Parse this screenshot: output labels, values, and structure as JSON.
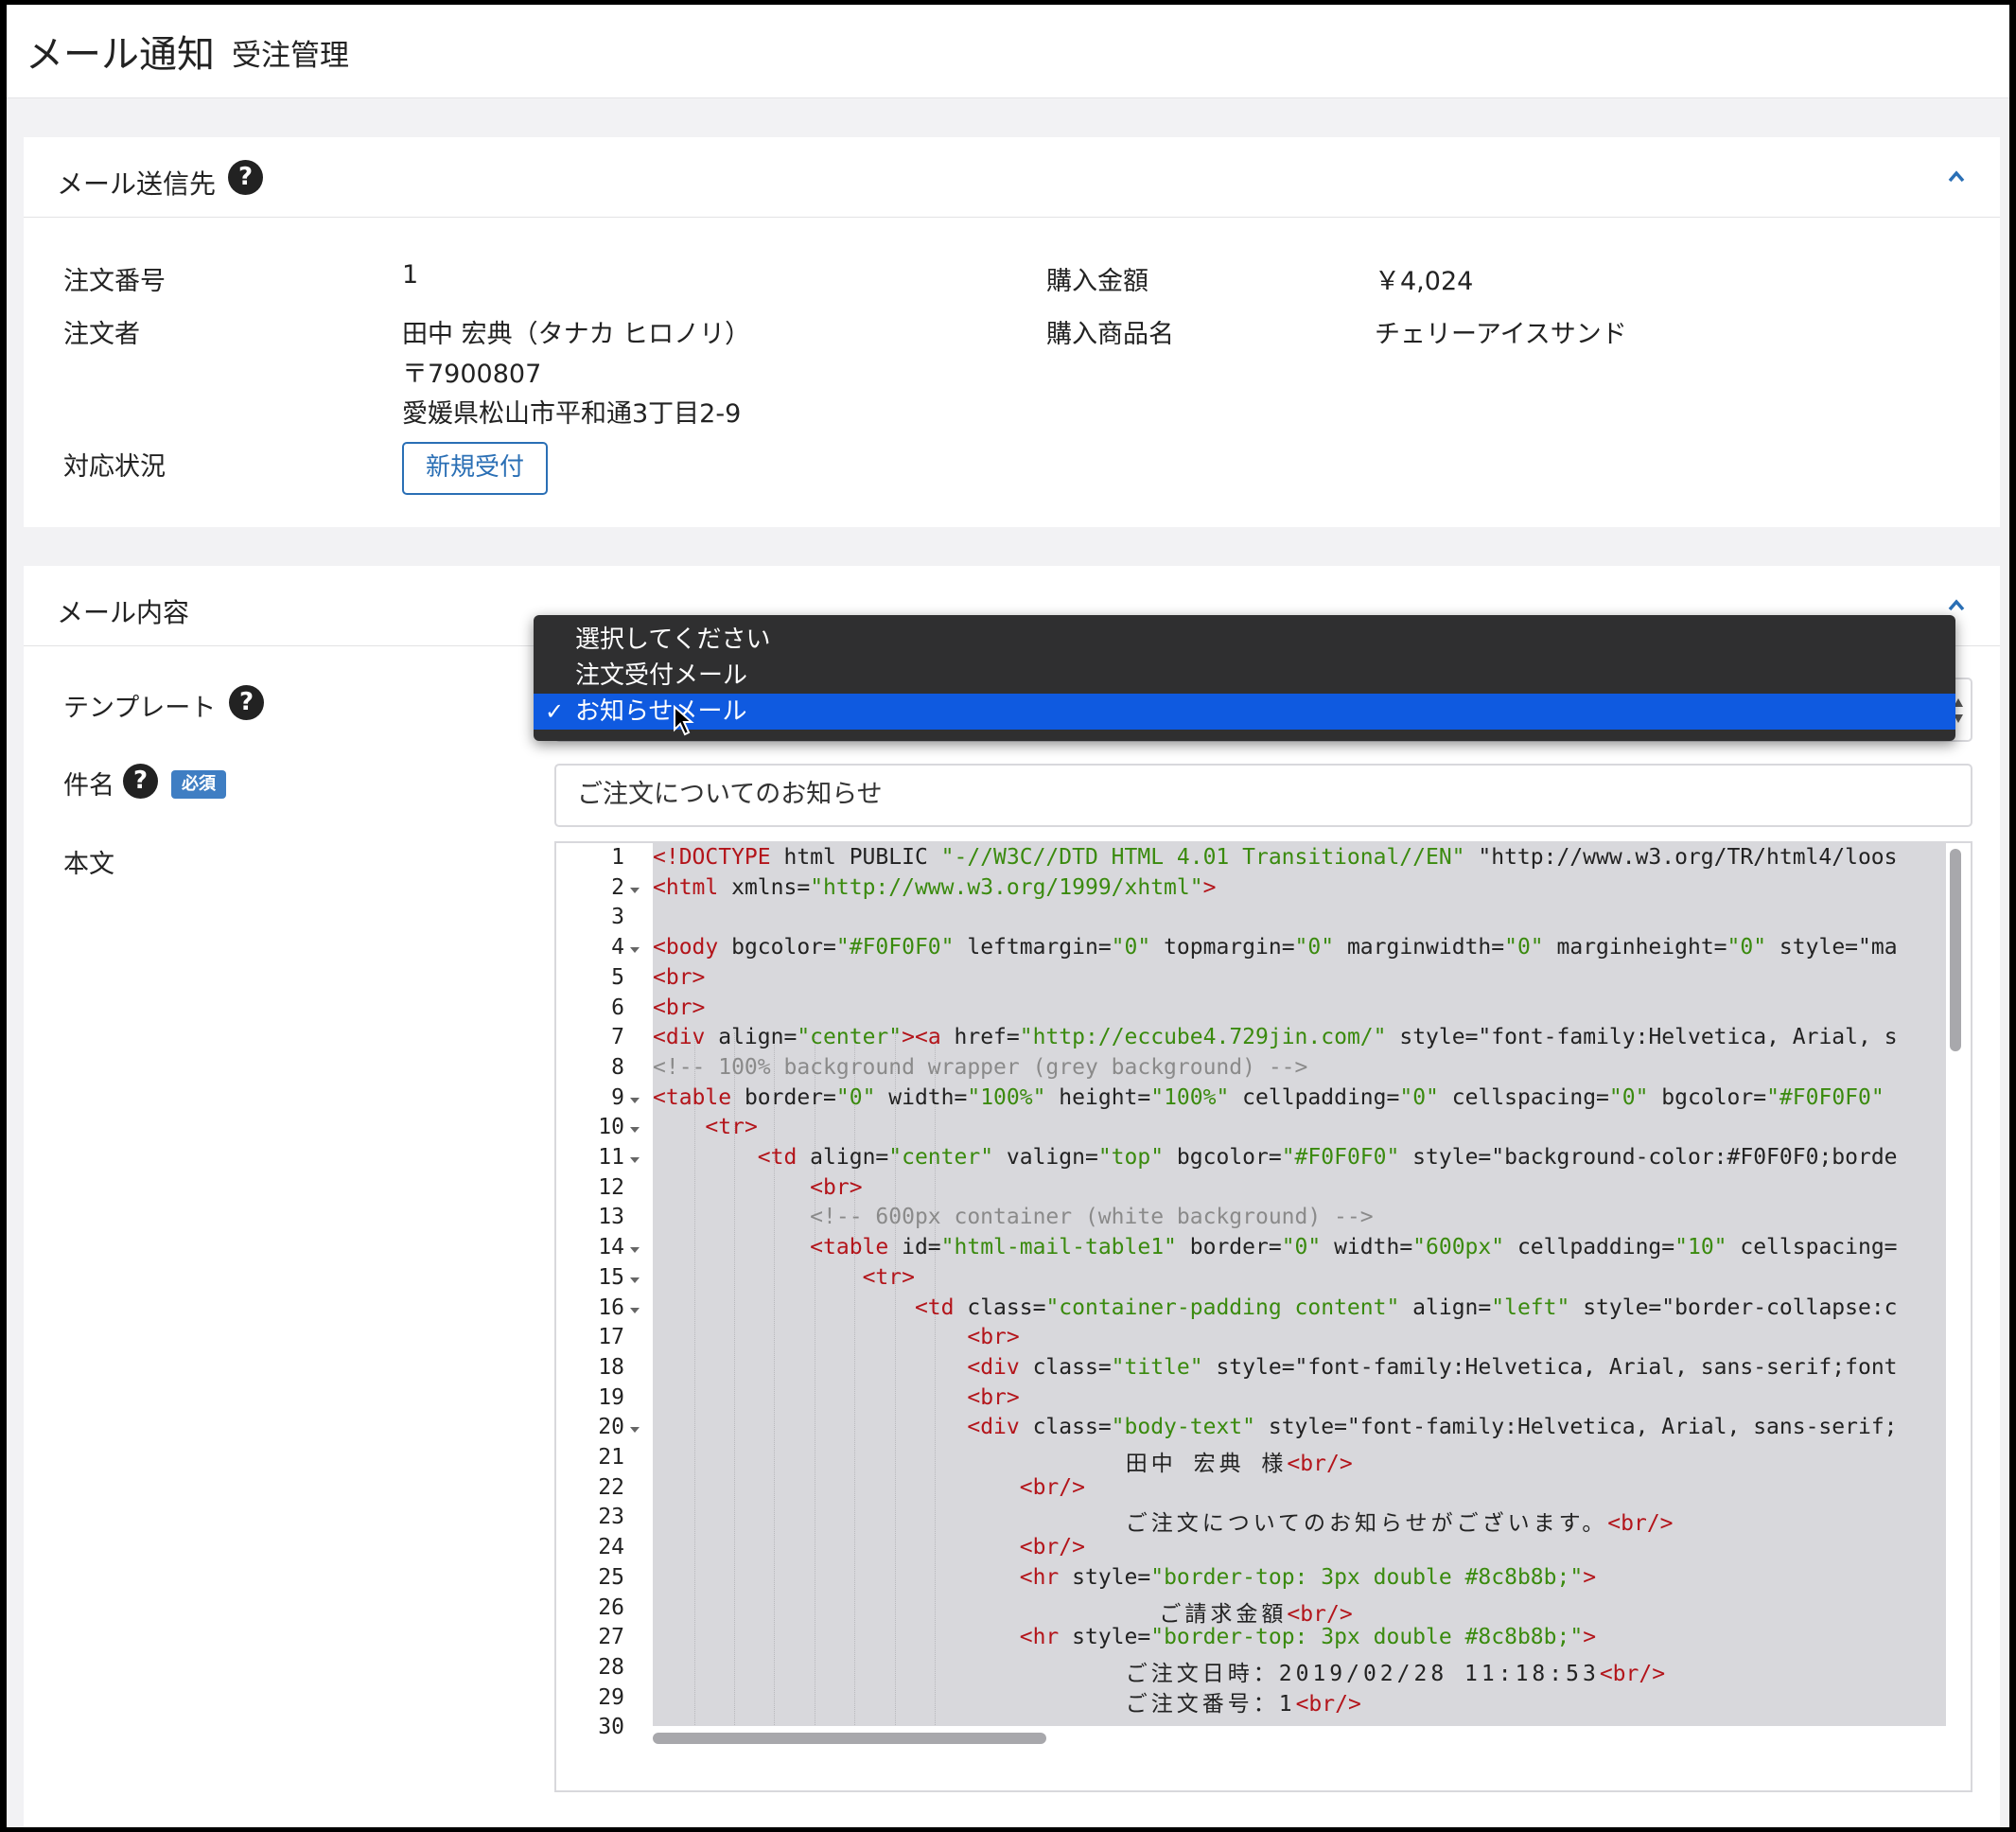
{
  "header": {
    "title": "メール通知",
    "subtitle": "受注管理"
  },
  "recipient": {
    "title": "メール送信先",
    "order_number_label": "注文番号",
    "order_number": "1",
    "purchase_amount_label": "購入金額",
    "purchase_amount": "￥4,024",
    "orderer_label": "注文者",
    "orderer_name": "田中 宏典（タナカ ヒロノリ）",
    "postal_code": "〒7900807",
    "address": "愛媛県松山市平和通3丁目2-9",
    "product_label": "購入商品名",
    "product_name": "チェリーアイスサンド",
    "status_label": "対応状況",
    "status": "新規受付"
  },
  "mail": {
    "title": "メール内容",
    "template_label": "テンプレート",
    "template_options": [
      "選択してください",
      "注文受付メール",
      "お知らせメール"
    ],
    "template_selected": "お知らせメール",
    "subject_label": "件名",
    "required_badge": "必須",
    "subject_value": "ご注文についてのお知らせ",
    "body_label": "本文"
  },
  "editor": {
    "line_numbers": [
      "1",
      "2",
      "3",
      "4",
      "5",
      "6",
      "7",
      "8",
      "9",
      "10",
      "11",
      "12",
      "13",
      "14",
      "15",
      "16",
      "17",
      "18",
      "19",
      "20",
      "21",
      "22",
      "23",
      "24",
      "25",
      "26",
      "27",
      "28",
      "29",
      "30"
    ],
    "lines": [
      "<!DOCTYPE html PUBLIC \"-//W3C//DTD HTML 4.01 Transitional//EN\" \"http://www.w3.org/TR/html4/loos",
      "<html xmlns=\"http://www.w3.org/1999/xhtml\">",
      "",
      "<body bgcolor=\"#F0F0F0\" leftmargin=\"0\" topmargin=\"0\" marginwidth=\"0\" marginheight=\"0\" style=\"ma",
      "<br>",
      "<br>",
      "<div align=\"center\"><a href=\"http://eccube4.729jin.com/\" style=\"font-family:Helvetica, Arial, s",
      "<!-- 100% background wrapper (grey background) -->",
      "<table border=\"0\" width=\"100%\" height=\"100%\" cellpadding=\"0\" cellspacing=\"0\" bgcolor=\"#F0F0F0\"",
      "    <tr>",
      "        <td align=\"center\" valign=\"top\" bgcolor=\"#F0F0F0\" style=\"background-color:#F0F0F0;borde",
      "            <br>",
      "            <!-- 600px container (white background) -->",
      "            <table id=\"html-mail-table1\" border=\"0\" width=\"600px\" cellpadding=\"10\" cellspacing=",
      "                <tr>",
      "                    <td class=\"container-padding content\" align=\"left\" style=\"border-collapse:c",
      "                        <br>",
      "                        <div class=\"title\" style=\"font-family:Helvetica, Arial, sans-serif;font",
      "                        <br>",
      "                        <div class=\"body-text\" style=\"font-family:Helvetica, Arial, sans-serif;",
      "                            田中 宏典 様<br/>",
      "                            <br/>",
      "                            ご注文についてのお知らせがございます。<br/>",
      "                            <br/>",
      "                            <hr style=\"border-top: 3px double #8c8b8b;\">",
      "                              ご請求金額<br/>",
      "                            <hr style=\"border-top: 3px double #8c8b8b;\">",
      "                            ご注文日時：2019/02/28 11:18:53<br/>",
      "                            ご注文番号：1<br/>",
      ""
    ],
    "foldable_lines": [
      2,
      4,
      9,
      10,
      11,
      14,
      15,
      16,
      20
    ]
  },
  "icons": {
    "help": "question-circle-icon",
    "collapse": "chevron-up-icon",
    "check": "checkmark-icon",
    "cursor": "mouse-pointer-icon",
    "select_arrows": "up-down-arrows-icon"
  },
  "colors": {
    "accent": "#2a6fb5",
    "required_badge": "#3f7ec3",
    "dropdown_bg": "#2f2f30",
    "dropdown_selected": "#0f5ae0",
    "code_bg": "#d8d8dc",
    "tag": "#b3141a",
    "string": "#3a8a0e",
    "comment": "#8a8a8a"
  }
}
